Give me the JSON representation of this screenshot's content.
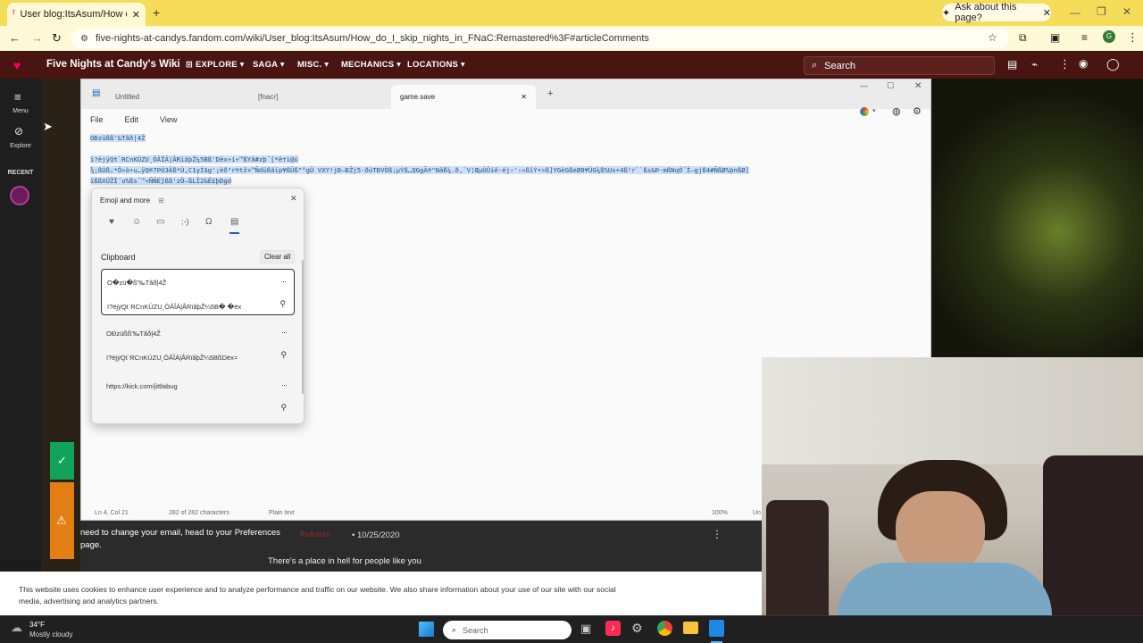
{
  "browser": {
    "tab_title": "User blog:ItsAsum/How do I sk",
    "new_tab_symbol": "+",
    "ask_page": "Ask about this page?",
    "url": "five-nights-at-candys.fandom.com/wiki/User_blog:ItsAsum/How_do_I_skip_nights_in_FNaC:Remastered%3F#articleComments"
  },
  "wiki": {
    "title": "Five Nights at Candy's Wiki",
    "nav": [
      "EXPLORE",
      "SAGA",
      "MISC.",
      "MECHANICS",
      "LOCATIONS"
    ],
    "search_placeholder": "Search",
    "rail": {
      "menu": "Menu",
      "explore": "Explore",
      "recent": "RECENT"
    }
  },
  "notepad": {
    "tabs": [
      "Untitled",
      "[fnacr]",
      "game.save"
    ],
    "menu": [
      "File",
      "Edit",
      "View"
    ],
    "text_lines": [
      "OÐzüßß'‰Tãð|4Ž",
      "ï?ëjÿQt`RCnKÜZU¸ÖÂÎÃ|ÃRïâþŽ¼5Bß'Dëx÷í÷™ßYã#zþ¯[*ê†ì@ü",
      "¾;ßÙß;*Ô»ò÷u…ÿQ®7ÞÙ3Âß*Ù,C1yÍ$g'¡èð³r®tž¤™Ñdüßãïp¥ßÜß\"°gÛ VXY!jÐ—ÐŽj5-ðùTÐVÖß;µÝß…QGgÃ®\"Näß¼.ð,`V¦ŒµÚÛíë·éj›'‹«ßïÝ•>ß]YGèGßeØ0¥ÜG¼ß%Us+4ß¹r``ßs&Þ-mßNqÖ¨Ï—gjß4#ÑßØ%þnßØ]",
      "ïßßXÜŽÏ´u%ßs¯™<ÑÑÉ}ßß'zÖ–ßLÏ2&Ë£þDgd"
    ],
    "status": {
      "position": "Ln 4, Col 21",
      "chars": "282 of 282 characters",
      "format": "Plain text",
      "zoom": "100%",
      "encoding": "Un"
    }
  },
  "emoji_panel": {
    "title": "Emoji and more",
    "section": "Clipboard",
    "clear_all": "Clear all",
    "items": [
      {
        "line1": "O�zü�ß'‰Tãð|4Ž",
        "line2": "ï?ëjÿQt`RCnKÜZU¸ÖÂÎÁ|ÂRïâþŽ¼5B� �ëx"
      },
      {
        "line1": "OÐzüßß'‰Tãð|4Ž",
        "line2": "ï?ëjÿQt`RCnKÜZU¸ÖÂÎÁ|ÂRïâþŽ¼5BßDëx≈"
      },
      {
        "line1": "https://kick.com/jittlabug",
        "line2": ""
      }
    ]
  },
  "page": {
    "warning": "need to change your email, head to your Preferences page.",
    "comment_author_date": "10/25/2020",
    "comment_text": "There's a place in hell for people like you",
    "cookie_text": "This website uses cookies to enhance user experience and to analyze performance and traffic on our website. We also share information about your use of our site with our social media, advertising and analytics partners."
  },
  "taskbar": {
    "weather_temp": "34°F",
    "weather_desc": "Mostly cloudy",
    "search": "Search"
  }
}
